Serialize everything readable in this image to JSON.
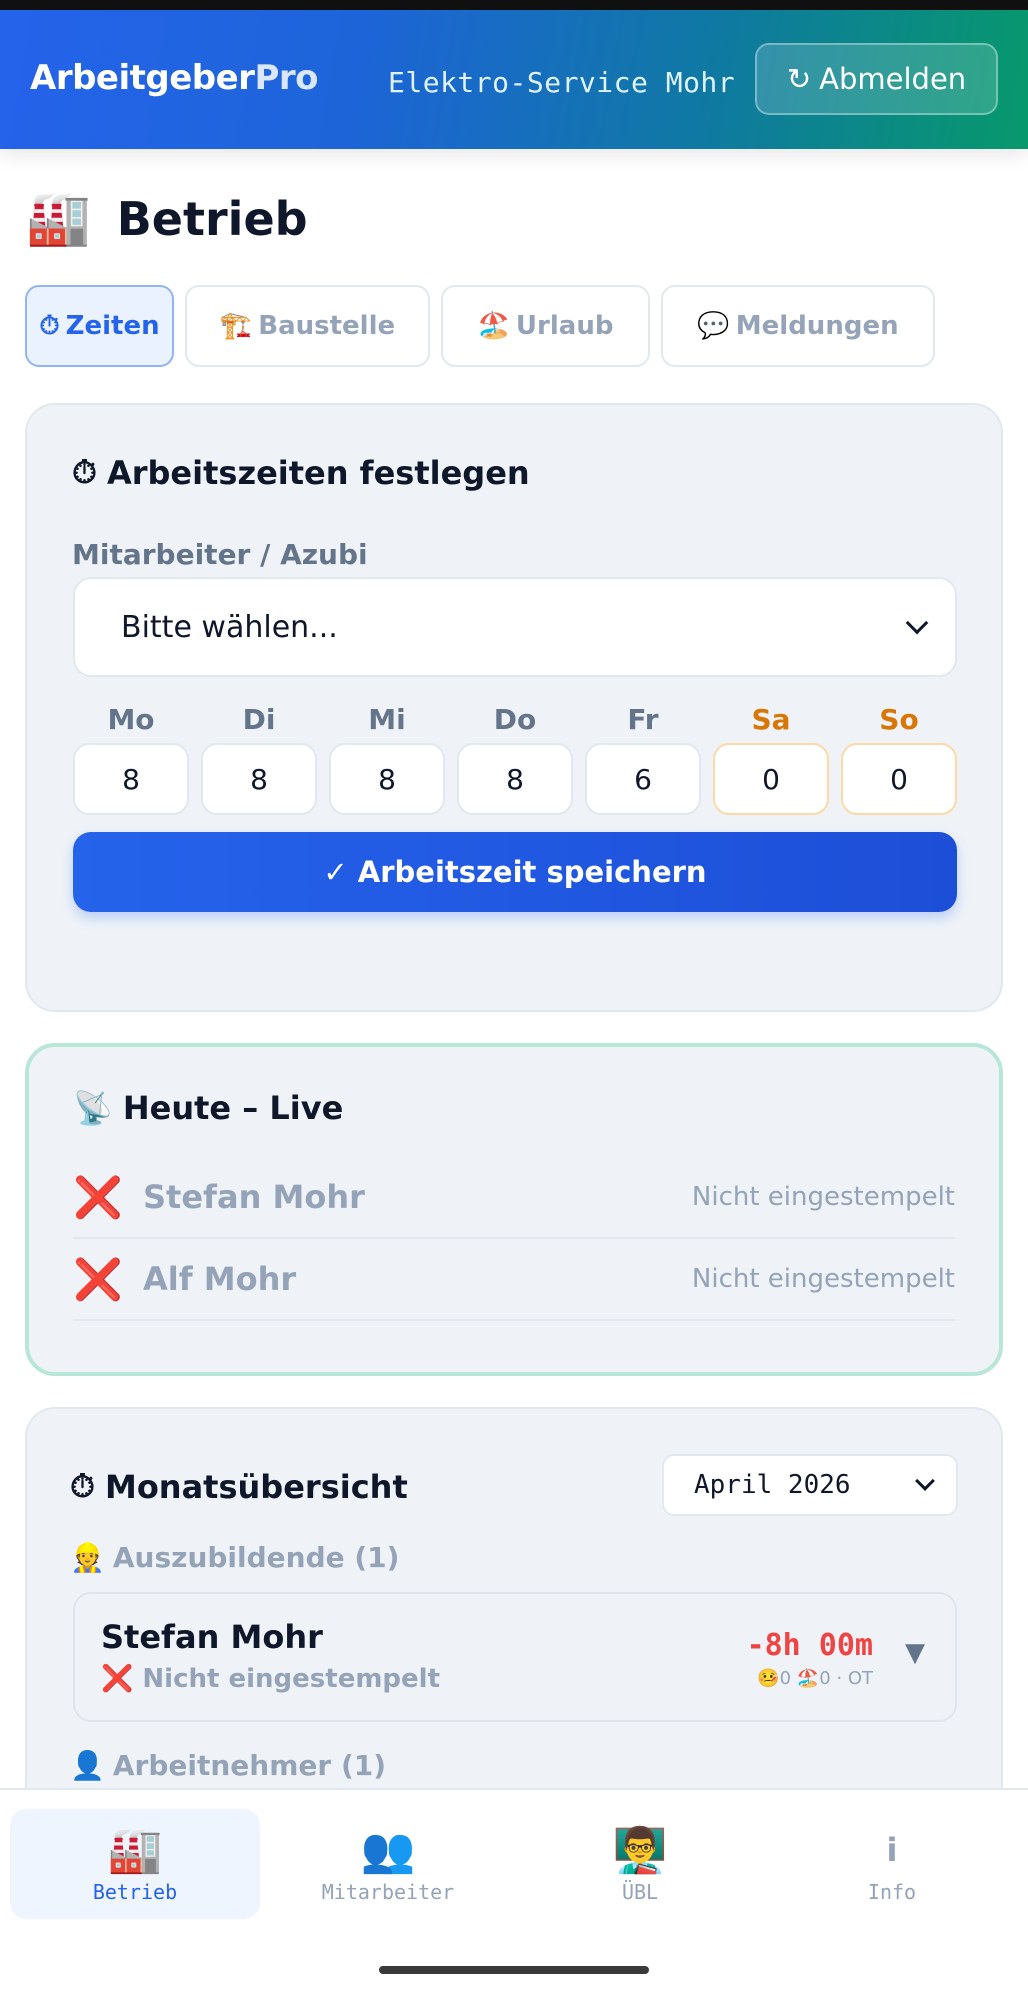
{
  "header": {
    "brand_main": "Arbeitgeber",
    "brand_accent": "Pro",
    "company": "Elektro-Service Mohr",
    "logout_icon": "↻",
    "logout_label": "Abmelden"
  },
  "page": {
    "icon": "🏭",
    "title": "Betrieb"
  },
  "tabs": [
    {
      "icon": "⏱",
      "label": "Zeiten",
      "active": true
    },
    {
      "icon": "🏗️",
      "label": "Baustelle"
    },
    {
      "icon": "🏖️",
      "label": "Urlaub"
    },
    {
      "icon": "💬",
      "label": "Meldungen"
    }
  ],
  "worktime": {
    "icon": "⏱",
    "title": "Arbeitszeiten festlegen",
    "employee_label": "Mitarbeiter / Azubi",
    "employee_value": "Bitte wählen...",
    "days": [
      {
        "label": "Mo",
        "value": "8"
      },
      {
        "label": "Di",
        "value": "8"
      },
      {
        "label": "Mi",
        "value": "8"
      },
      {
        "label": "Do",
        "value": "8"
      },
      {
        "label": "Fr",
        "value": "6"
      },
      {
        "label": "Sa",
        "value": "0"
      },
      {
        "label": "So",
        "value": "0"
      }
    ],
    "save_label": "✓ Arbeitszeit speichern"
  },
  "live": {
    "icon": "📡",
    "title": "Heute – Live",
    "rows": [
      {
        "icon": "❌",
        "name": "Stefan Mohr",
        "status": "Nicht eingestempelt"
      },
      {
        "icon": "❌",
        "name": "Alf Mohr",
        "status": "Nicht eingestempelt"
      }
    ]
  },
  "month": {
    "icon": "⏱",
    "title": "Monatsübersicht",
    "selected_month": "April 2026",
    "groups": [
      {
        "icon": "👷",
        "label": "Auszubildende (1)"
      },
      {
        "icon": "👤",
        "label": "Arbeitnehmer (1)"
      }
    ],
    "employee": {
      "name": "Stefan Mohr",
      "status": "❌ Nicht eingestempelt",
      "hours": "-8h 00m",
      "badges": "🤒0 🏖️0 · OT",
      "toggle": "▼"
    }
  },
  "nav": [
    {
      "icon": "🏭",
      "label": "Betrieb",
      "active": true
    },
    {
      "icon": "👥",
      "label": "Mitarbeiter"
    },
    {
      "icon": "👨‍🏫",
      "label": "ÜBL"
    },
    {
      "icon": "i",
      "label": "Info"
    }
  ],
  "colors": {
    "primary": "#2563eb",
    "accent_green": "#07996b",
    "danger": "#ef4444",
    "weekend": "#d97706"
  }
}
